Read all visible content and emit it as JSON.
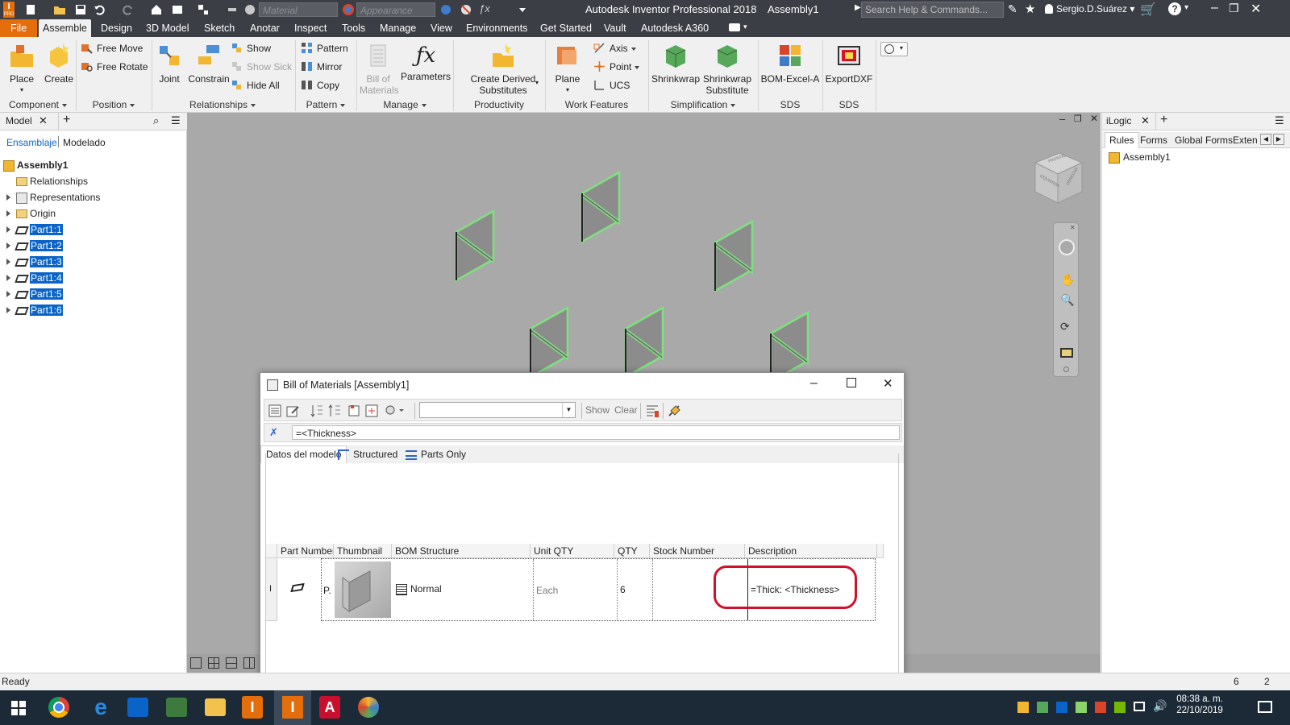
{
  "titlebar": {
    "app_title": "Autodesk Inventor Professional 2018",
    "doc_title": "Assembly1",
    "material_placeholder": "Material",
    "appearance_placeholder": "Appearance",
    "search_placeholder": "Search Help & Commands...",
    "user": "Sergio.D.Suárez",
    "help": "?",
    "pro_badge": "PRO"
  },
  "tabs": [
    "File",
    "Assemble",
    "Design",
    "3D Model",
    "Sketch",
    "Anotar",
    "Inspect",
    "Tools",
    "Manage",
    "View",
    "Environments",
    "Get Started",
    "Vault",
    "Autodesk A360"
  ],
  "ribbon": {
    "place": "Place",
    "create": "Create",
    "free_move": "Free Move",
    "free_rotate": "Free Rotate",
    "joint": "Joint",
    "constrain": "Constrain",
    "show": "Show",
    "show_sick": "Show Sick",
    "hide_all": "Hide All",
    "pattern": "Pattern",
    "mirror": "Mirror",
    "copy": "Copy",
    "bom": "Bill of",
    "bom2": "Materials",
    "parameters": "Parameters",
    "cds1": "Create Derived",
    "cds2": "Substitutes",
    "plane": "Plane",
    "axis": "Axis",
    "point": "Point",
    "ucs": "UCS",
    "shrinkwrap": "Shrinkwrap",
    "shrinkwrap_sub1": "Shrinkwrap",
    "shrinkwrap_sub2": "Substitute",
    "bom_excel": "BOM-Excel-A",
    "export_dxf": "ExportDXF",
    "groups": {
      "component": "Component",
      "position": "Position",
      "relationships": "Relationships",
      "pattern": "Pattern",
      "manage": "Manage",
      "productivity": "Productivity",
      "work_features": "Work Features",
      "simplification": "Simplification",
      "sds1": "SDS",
      "sds2": "SDS"
    }
  },
  "browser": {
    "tab": "Model",
    "sub1": "Ensamblaje",
    "sub2": "Modelado",
    "root": "Assembly1",
    "items": [
      "Relationships",
      "Representations",
      "Origin"
    ],
    "parts": [
      "Part1:1",
      "Part1:2",
      "Part1:3",
      "Part1:4",
      "Part1:5",
      "Part1:6"
    ]
  },
  "ilogic": {
    "tab": "iLogic",
    "subtabs": [
      "Rules",
      "Forms",
      "Global Forms",
      "Exten"
    ],
    "item": "Assembly1"
  },
  "viewcube": {
    "front": "FRONTAL",
    "right": "DERECHA",
    "left": "IZQUIERDA"
  },
  "bom": {
    "title": "Bill of Materials [Assembly1]",
    "show": "Show",
    "clear": "Clear",
    "formula": "=<Thickness>",
    "tabs": [
      "Datos del modelo",
      "Structured",
      "Parts Only"
    ],
    "columns": [
      "Part Number",
      "Thumbnail",
      "BOM Structure",
      "Unit QTY",
      "QTY",
      "Stock Number",
      "Description"
    ],
    "row": {
      "part_number": "P.",
      "bom_structure": "Normal",
      "unit_qty": "Each",
      "qty": "6",
      "stock_number": "",
      "description": "=Thick: <Thickness>"
    },
    "highlight_color": "#d0112b"
  },
  "status": {
    "text": "Ready",
    "count1": "6",
    "count2": "2"
  },
  "clock": {
    "time": "08:38 a. m.",
    "date": "22/10/2019"
  }
}
